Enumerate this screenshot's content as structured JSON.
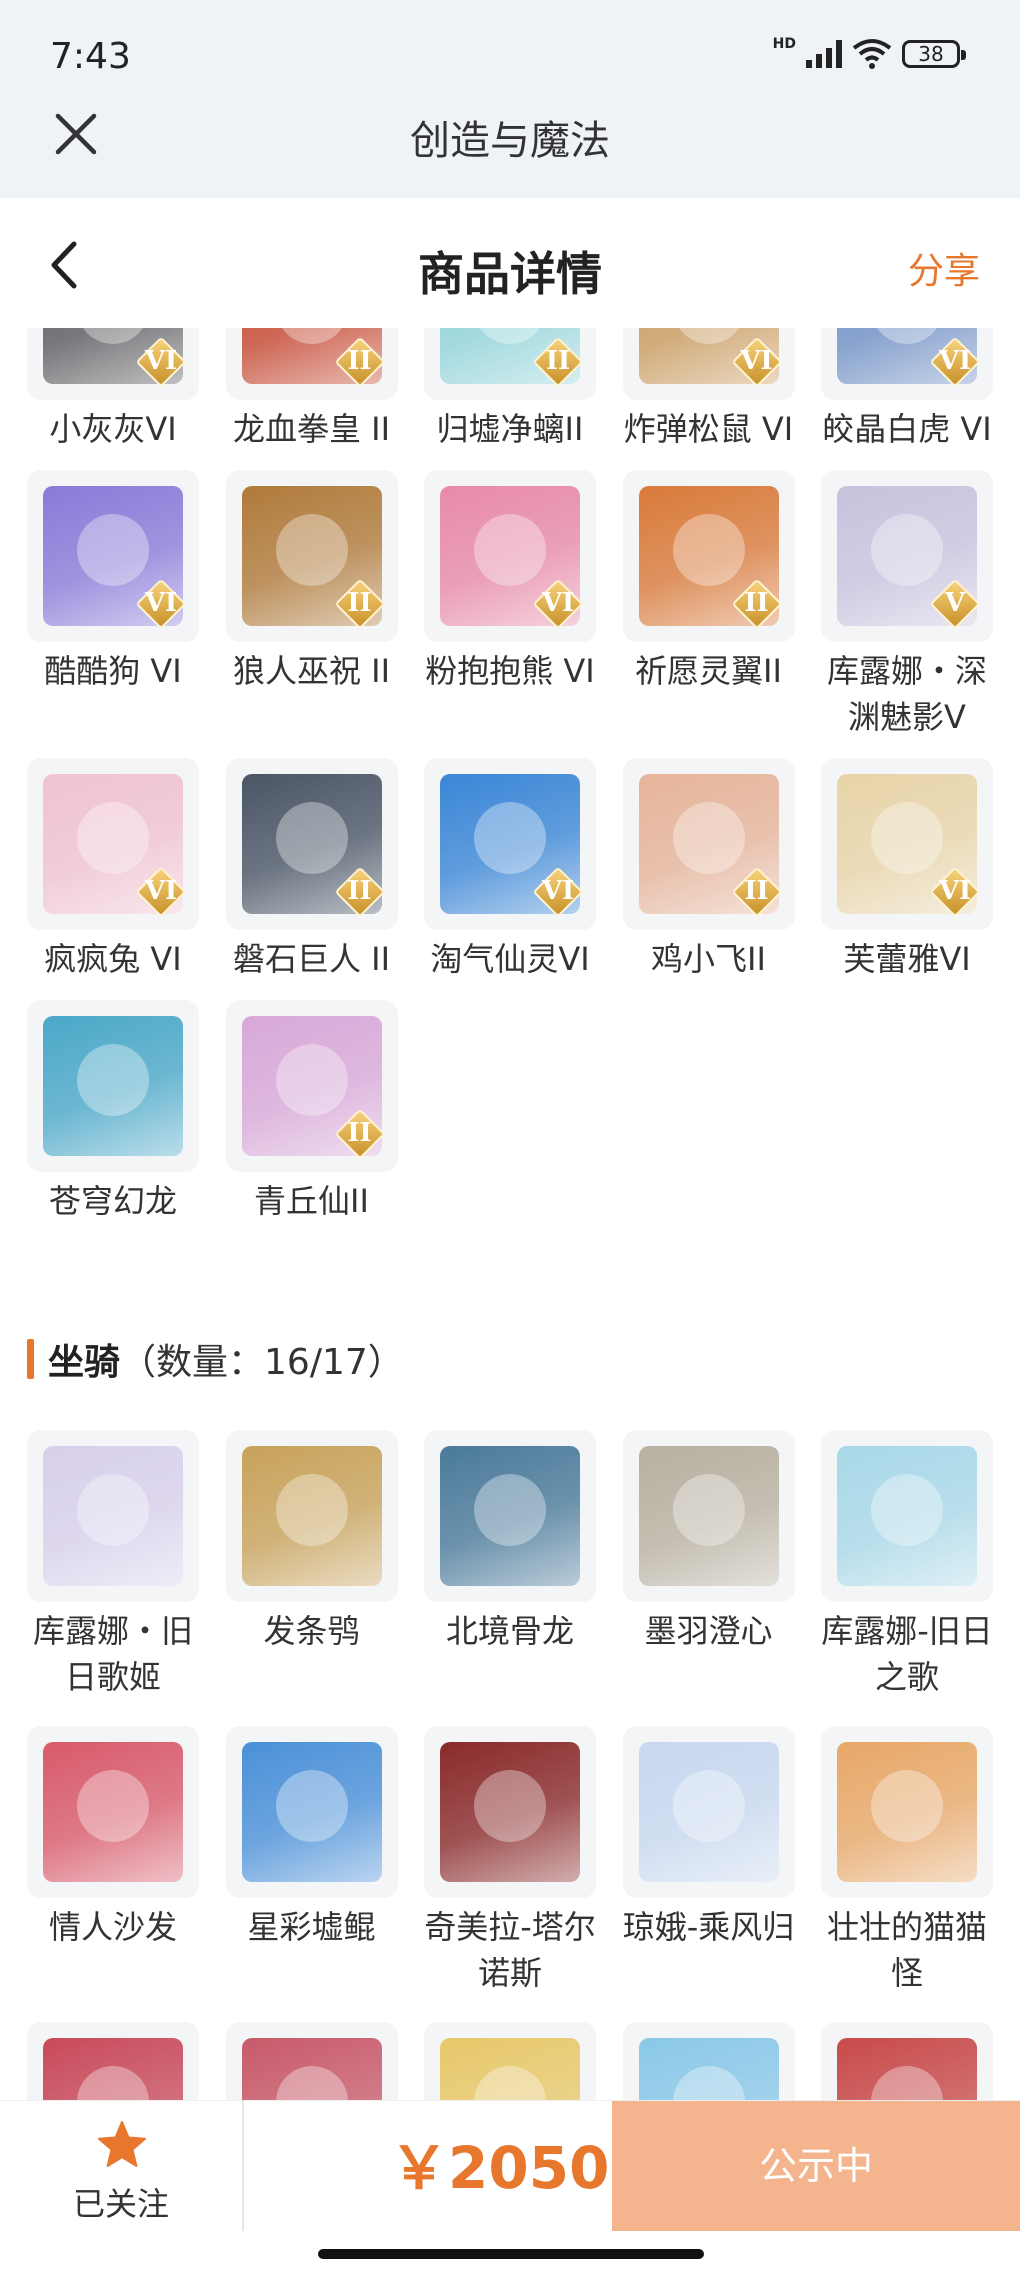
{
  "status_bar": {
    "time": "7:43",
    "network": "HD",
    "battery": "38"
  },
  "app": {
    "title": "创造与魔法"
  },
  "header": {
    "title": "商品详情",
    "share": "分享"
  },
  "pets": [
    {
      "name": "小灰灰VI",
      "badge": "VI",
      "icon": "gray-wolf-pet-icon",
      "color": "#5a5a5e"
    },
    {
      "name": "龙血拳皇 II",
      "badge": "II",
      "icon": "dragon-boxer-pet-icon",
      "color": "#c5452e"
    },
    {
      "name": "归墟净螭II",
      "badge": "II",
      "icon": "water-dragon-pet-icon",
      "color": "#8fd3d9"
    },
    {
      "name": "炸弹松鼠 VI",
      "badge": "VI",
      "icon": "bomb-squirrel-pet-icon",
      "color": "#c99a5c"
    },
    {
      "name": "皎晶白虎 VI",
      "badge": "VI",
      "icon": "white-tiger-pet-icon",
      "color": "#6e8fc4"
    },
    {
      "name": "酷酷狗 VI",
      "badge": "VI",
      "icon": "cool-dog-pet-icon",
      "color": "#8a7ad8"
    },
    {
      "name": "狼人巫祝 II",
      "badge": "II",
      "icon": "werewolf-shaman-pet-icon",
      "color": "#b07a3a"
    },
    {
      "name": "粉抱抱熊 VI",
      "badge": "VI",
      "icon": "pink-bear-pet-icon",
      "color": "#e88aa8"
    },
    {
      "name": "祈愿灵翼II",
      "badge": "II",
      "icon": "spirit-wing-pet-icon",
      "color": "#d97a3a"
    },
    {
      "name": "库露娜・深渊魅影V",
      "badge": "V",
      "icon": "kuluna-abyss-pet-icon",
      "color": "#c9c2de"
    },
    {
      "name": "疯疯兔 VI",
      "badge": "VI",
      "icon": "crazy-rabbit-pet-icon",
      "color": "#f0c2d2"
    },
    {
      "name": "磐石巨人 II",
      "badge": "II",
      "icon": "rock-giant-pet-icon",
      "color": "#4a5565"
    },
    {
      "name": "淘气仙灵VI",
      "badge": "VI",
      "icon": "naughty-fairy-pet-icon",
      "color": "#3a86d6"
    },
    {
      "name": "鸡小飞II",
      "badge": "II",
      "icon": "chicken-fly-pet-icon",
      "color": "#e6b49a"
    },
    {
      "name": "芙蕾雅VI",
      "badge": "VI",
      "icon": "freya-pet-icon",
      "color": "#e8d4a8"
    },
    {
      "name": "苍穹幻龙",
      "badge": "",
      "icon": "sky-dragon-pet-icon",
      "color": "#4aa8c8"
    },
    {
      "name": "青丘仙II",
      "badge": "II",
      "icon": "qingqiu-fox-pet-icon",
      "color": "#d8a8d8"
    }
  ],
  "mounts_section": {
    "title": "坐骑",
    "count": "（数量：16/17）"
  },
  "mounts": [
    {
      "name": "库露娜・旧日歌姬",
      "icon": "kuluna-songstress-mount-icon",
      "color": "#d8d0ec"
    },
    {
      "name": "发条鸮",
      "icon": "clockwork-owl-mount-icon",
      "color": "#c8a25a"
    },
    {
      "name": "北境骨龙",
      "icon": "north-bone-dragon-mount-icon",
      "color": "#4a7a9a"
    },
    {
      "name": "墨羽澄心",
      "icon": "ink-feather-mount-icon",
      "color": "#b8b0a0"
    },
    {
      "name": "库露娜-旧日之歌",
      "icon": "kuluna-old-song-mount-icon",
      "color": "#a8d8e8"
    },
    {
      "name": "情人沙发",
      "icon": "lovers-sofa-mount-icon",
      "color": "#d85a6a"
    },
    {
      "name": "星彩墟鲲",
      "icon": "star-kun-whale-mount-icon",
      "color": "#4a90d8"
    },
    {
      "name": "奇美拉-塔尔诺斯",
      "icon": "chimera-tarnos-mount-icon",
      "color": "#8a2a2a"
    },
    {
      "name": "琼娥-乘风归",
      "icon": "qiong-e-mount-icon",
      "color": "#c8d8f0"
    },
    {
      "name": "壮壮的猫猫怪",
      "icon": "chubby-cat-mount-icon",
      "color": "#e8a868"
    },
    {
      "name": "",
      "icon": "red-dragon-mount-icon",
      "color": "#c84a5a"
    },
    {
      "name": "",
      "icon": "crimson-dragon-mount-icon",
      "color": "#c85a6a"
    },
    {
      "name": "",
      "icon": "golden-crown-mount-icon",
      "color": "#e8c86a"
    },
    {
      "name": "",
      "icon": "ice-dragon-mount-icon",
      "color": "#8ac8e8"
    },
    {
      "name": "",
      "icon": "flame-dragon-mount-icon",
      "color": "#c84a4a"
    }
  ],
  "bottom_bar": {
    "follow_label": "已关注",
    "price": "￥2050",
    "status": "公示中"
  },
  "colors": {
    "accent": "#e8772e",
    "status_button": "#f4b48e"
  }
}
